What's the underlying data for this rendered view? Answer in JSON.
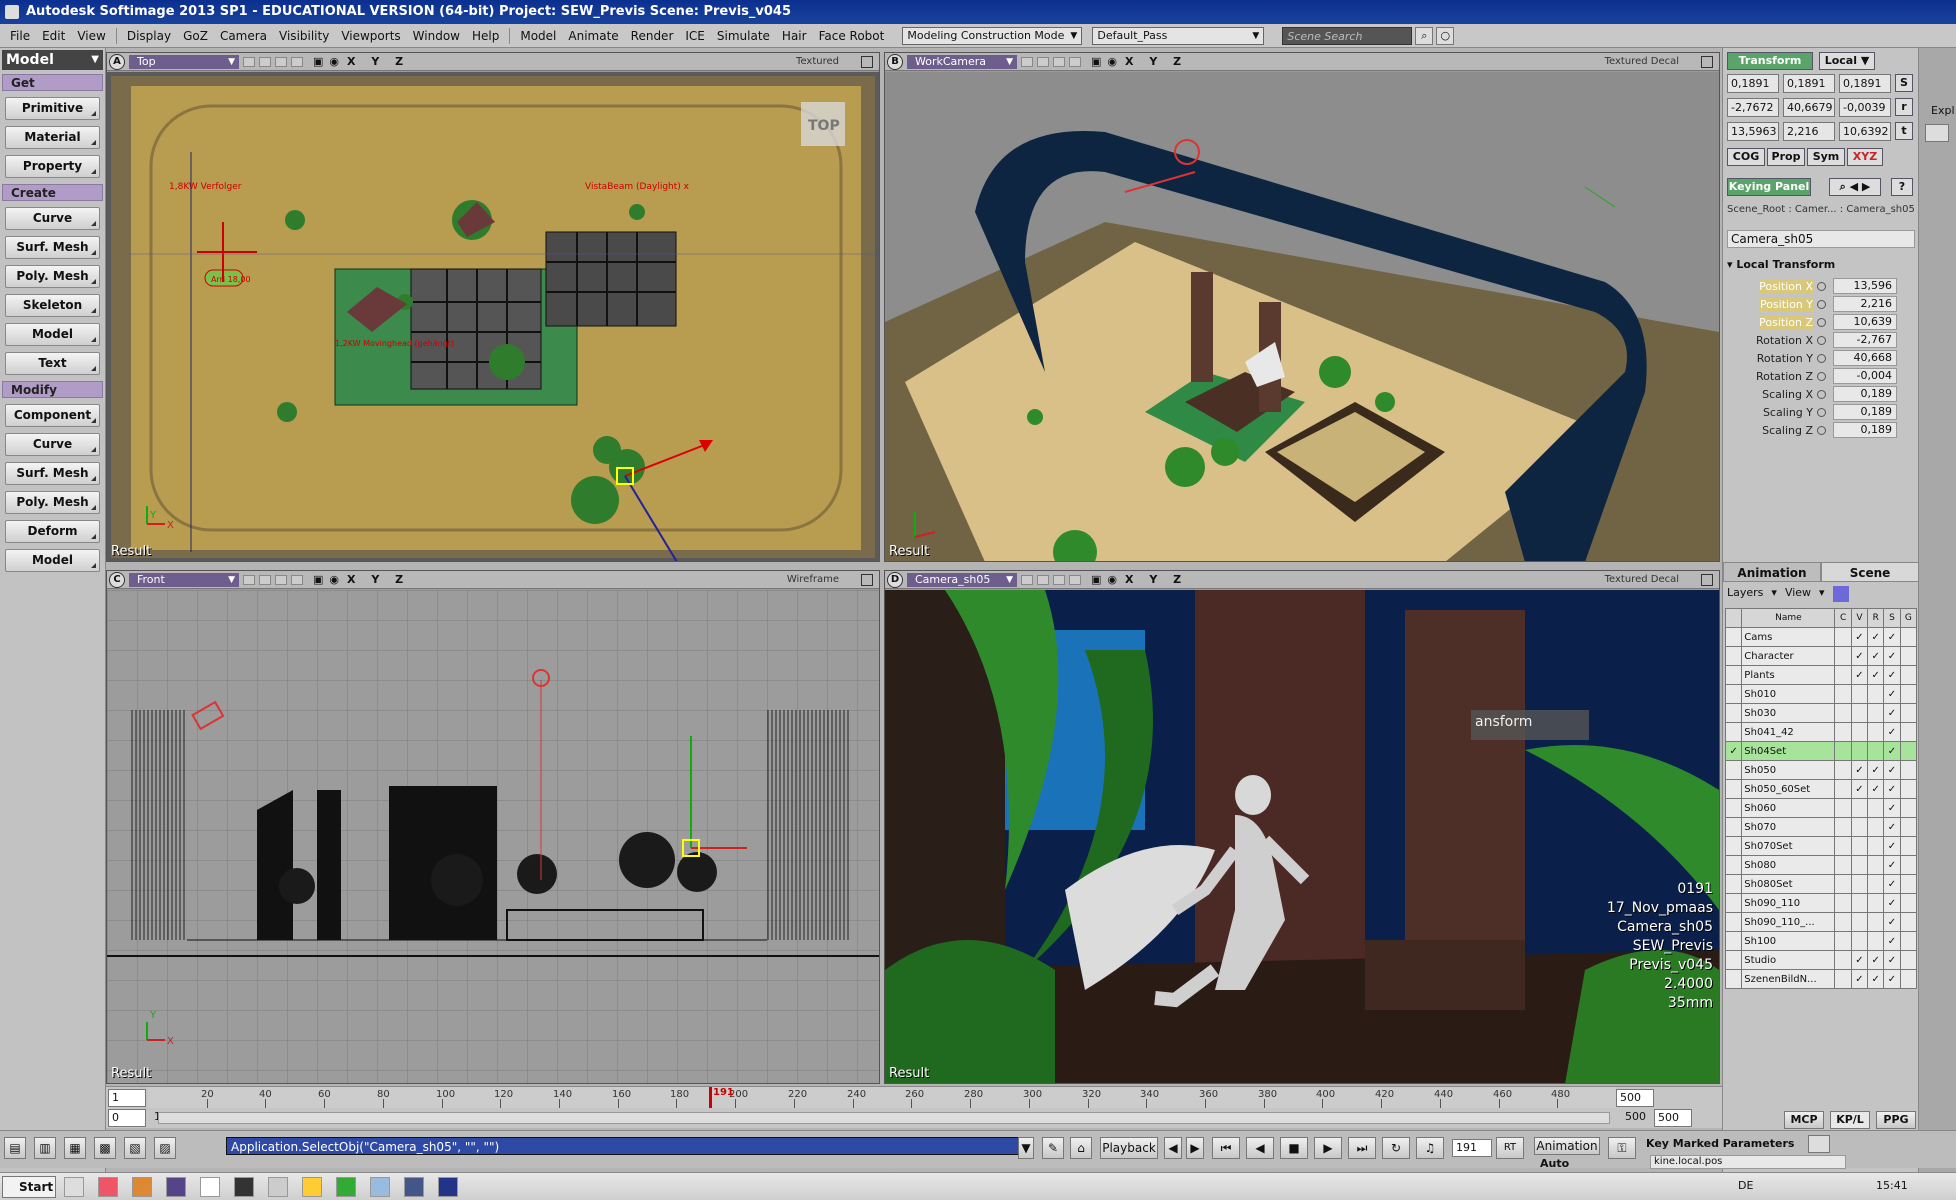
{
  "window": {
    "title": "Autodesk Softimage 2013 SP1  -  EDUCATIONAL VERSION (64-bit)    Project: SEW_Previs    Scene: Previs_v045"
  },
  "menu": {
    "items": [
      "File",
      "Edit",
      "View",
      "Display",
      "GoZ",
      "Camera",
      "Visibility",
      "Viewports",
      "Window",
      "Help",
      "Model",
      "Animate",
      "Render",
      "ICE",
      "Simulate",
      "Hair",
      "Face Robot"
    ],
    "construction_mode": "Modeling Construction Mode",
    "render_pass": "Default_Pass",
    "search_placeholder": "Scene Search"
  },
  "left_panel": {
    "mode": "Model",
    "sections": [
      {
        "title": "Get",
        "buttons": [
          "Primitive",
          "Material",
          "Property"
        ]
      },
      {
        "title": "Create",
        "buttons": [
          "Curve",
          "Surf. Mesh",
          "Poly. Mesh",
          "Skeleton",
          "Model",
          "Text"
        ]
      },
      {
        "title": "Modify",
        "buttons": [
          "Component",
          "Curve",
          "Surf. Mesh",
          "Poly. Mesh",
          "Deform",
          "Model"
        ]
      }
    ]
  },
  "viewports": {
    "a": {
      "label": "A",
      "camera": "Top",
      "mode": "Textured",
      "axes": "X Y Z",
      "result": "Result",
      "badge": "TOP",
      "annotations": [
        "1,8KW Verfolger",
        "VistaBeam (Daylight) x",
        "Arri 18,00",
        "1,2KW Movinghead (gehängt)"
      ]
    },
    "b": {
      "label": "B",
      "camera": "WorkCamera",
      "mode": "Textured Decal",
      "axes": "X Y Z",
      "result": "Result"
    },
    "c": {
      "label": "C",
      "camera": "Front",
      "mode": "Wireframe",
      "axes": "X Y Z",
      "result": "Result"
    },
    "d": {
      "label": "D",
      "camera": "Camera_sh05",
      "mode": "Textured Decal",
      "axes": "X Y Z",
      "result": "Result",
      "overlay_panel": "ansform",
      "hud": [
        "0191",
        "17_Nov_pmaas",
        "Camera_sh05",
        "SEW_Previs",
        "Previs_v045",
        "2.4000",
        "35mm"
      ]
    }
  },
  "transform_panel": {
    "tab": "Transform",
    "space": "Local",
    "scale": [
      "0,1891",
      "0,1891",
      "0,1891"
    ],
    "rotation": [
      "-2,7672",
      "40,6679",
      "-0,0039"
    ],
    "translation": [
      "13,5963",
      "2,216",
      "10,6392"
    ],
    "buttons": [
      "COG",
      "Prop",
      "Sym"
    ],
    "keying_panel": "Keying Panel",
    "breadcrumb": "Scene_Root : Camer... : Camera_sh05",
    "object_name": "Camera_sh05",
    "section": "Local Transform",
    "params": [
      {
        "name": "Position X",
        "value": "13,596",
        "highlight": true
      },
      {
        "name": "Position Y",
        "value": "2,216",
        "highlight": true
      },
      {
        "name": "Position Z",
        "value": "10,639",
        "highlight": true
      },
      {
        "name": "Rotation X",
        "value": "-2,767",
        "highlight": false
      },
      {
        "name": "Rotation Y",
        "value": "40,668",
        "highlight": false
      },
      {
        "name": "Rotation Z",
        "value": "-0,004",
        "highlight": false
      },
      {
        "name": "Scaling X",
        "value": "0,189",
        "highlight": false
      },
      {
        "name": "Scaling Y",
        "value": "0,189",
        "highlight": false
      },
      {
        "name": "Scaling Z",
        "value": "0,189",
        "highlight": false
      }
    ],
    "explorer_fragment": "Expl"
  },
  "scene_panel": {
    "tabs": [
      "Animation",
      "Scene"
    ],
    "layers_label": "Layers",
    "view_label": "View",
    "columns": [
      "Name",
      "C",
      "V",
      "R",
      "S",
      "G"
    ],
    "layers": [
      {
        "name": "Cams",
        "v": "✓",
        "r": "✓",
        "s": "✓",
        "g": "",
        "active": "",
        "sel": false
      },
      {
        "name": "Character",
        "v": "✓",
        "r": "✓",
        "s": "✓",
        "g": "",
        "active": "",
        "sel": false
      },
      {
        "name": "Plants",
        "v": "✓",
        "r": "✓",
        "s": "✓",
        "g": "",
        "active": "",
        "sel": false
      },
      {
        "name": "Sh010",
        "v": "",
        "r": "",
        "s": "✓",
        "g": "",
        "active": "",
        "sel": false
      },
      {
        "name": "Sh030",
        "v": "",
        "r": "",
        "s": "✓",
        "g": "",
        "active": "",
        "sel": false
      },
      {
        "name": "Sh041_42",
        "v": "",
        "r": "",
        "s": "✓",
        "g": "",
        "active": "",
        "sel": false
      },
      {
        "name": "Sh04Set",
        "v": "",
        "r": "",
        "s": "✓",
        "g": "",
        "active": "✓",
        "sel": true
      },
      {
        "name": "Sh050",
        "v": "✓",
        "r": "✓",
        "s": "✓",
        "g": "",
        "active": "",
        "sel": false
      },
      {
        "name": "Sh050_60Set",
        "v": "✓",
        "r": "✓",
        "s": "✓",
        "g": "",
        "active": "",
        "sel": false
      },
      {
        "name": "Sh060",
        "v": "",
        "r": "",
        "s": "✓",
        "g": "",
        "active": "",
        "sel": false
      },
      {
        "name": "Sh070",
        "v": "",
        "r": "",
        "s": "✓",
        "g": "",
        "active": "",
        "sel": false
      },
      {
        "name": "Sh070Set",
        "v": "",
        "r": "",
        "s": "✓",
        "g": "",
        "active": "",
        "sel": false
      },
      {
        "name": "Sh080",
        "v": "",
        "r": "",
        "s": "✓",
        "g": "",
        "active": "",
        "sel": false
      },
      {
        "name": "Sh080Set",
        "v": "",
        "r": "",
        "s": "✓",
        "g": "",
        "active": "",
        "sel": false
      },
      {
        "name": "Sh090_110",
        "v": "",
        "r": "",
        "s": "✓",
        "g": "",
        "active": "",
        "sel": false
      },
      {
        "name": "Sh090_110_...",
        "v": "",
        "r": "",
        "s": "✓",
        "g": "",
        "active": "",
        "sel": false
      },
      {
        "name": "Sh100",
        "v": "",
        "r": "",
        "s": "✓",
        "g": "",
        "active": "",
        "sel": false
      },
      {
        "name": "Studio",
        "v": "✓",
        "r": "✓",
        "s": "✓",
        "g": "",
        "active": "",
        "sel": false
      },
      {
        "name": "SzenenBildN...",
        "v": "✓",
        "r": "✓",
        "s": "✓",
        "g": "",
        "active": "",
        "sel": false
      }
    ]
  },
  "timeline": {
    "start": "1",
    "start_field": "0",
    "end_top": "500",
    "end_bottom": "500",
    "end_field": "500",
    "current_frame": "191",
    "ticks": [
      "20",
      "40",
      "60",
      "80",
      "100",
      "120",
      "140",
      "160",
      "180",
      "200",
      "220",
      "240",
      "260",
      "280",
      "300",
      "320",
      "340",
      "360",
      "380",
      "400",
      "420",
      "440",
      "460",
      "480"
    ]
  },
  "command": {
    "text": "Application.SelectObj(\"Camera_sh05\", \"\", \"\")",
    "playback": "Playback",
    "frame": "191",
    "rt": "RT",
    "animation": "Animation",
    "auto": "Auto",
    "key_marked": "Key Marked Parameters",
    "kine": "kine.local.pos",
    "tabs": [
      "MCP",
      "KP/L",
      "PPG"
    ]
  },
  "taskbar": {
    "start": "Start",
    "lang": "DE",
    "time": "15:41"
  },
  "colors": {
    "title_bg": "#0c2f8f",
    "purple_header": "#b09cc6",
    "vp_cam_bg": "#6d5e8e",
    "selected_layer": "#a7e39a",
    "cmd_bg": "#2f4aa5",
    "frame_marker": "#cc0000"
  }
}
